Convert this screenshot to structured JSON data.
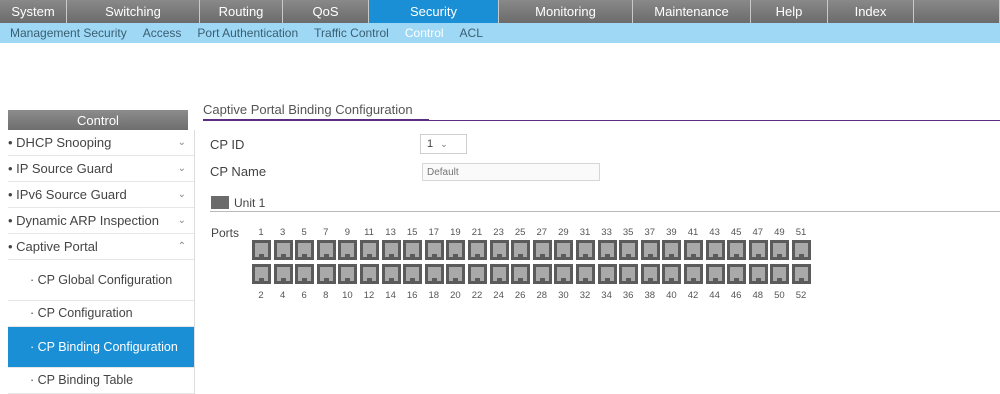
{
  "nav": {
    "tabs": [
      {
        "label": "System",
        "width": 67,
        "active": false
      },
      {
        "label": "Switching",
        "width": 133,
        "active": false
      },
      {
        "label": "Routing",
        "width": 83,
        "active": false
      },
      {
        "label": "QoS",
        "width": 86,
        "active": false
      },
      {
        "label": "Security",
        "width": 130,
        "active": true
      },
      {
        "label": "Monitoring",
        "width": 134,
        "active": false
      },
      {
        "label": "Maintenance",
        "width": 118,
        "active": false
      },
      {
        "label": "Help",
        "width": 77,
        "active": false
      },
      {
        "label": "Index",
        "width": 86,
        "active": false
      },
      {
        "label": "",
        "width": 86,
        "active": false
      }
    ],
    "subitems": [
      {
        "label": "Management Security",
        "active": false
      },
      {
        "label": "Access",
        "active": false
      },
      {
        "label": "Port Authentication",
        "active": false
      },
      {
        "label": "Traffic Control",
        "active": false
      },
      {
        "label": "Control",
        "active": true
      },
      {
        "label": "ACL",
        "active": false
      }
    ]
  },
  "sidebar": {
    "title": "Control",
    "items": [
      {
        "label": "• DHCP Snooping",
        "chevron": "⌄",
        "sub": false
      },
      {
        "label": "• IP Source Guard",
        "chevron": "⌄",
        "sub": false
      },
      {
        "label": "• IPv6 Source Guard",
        "chevron": "⌄",
        "sub": false
      },
      {
        "label": "• Dynamic ARP Inspection",
        "chevron": "⌄",
        "sub": false
      },
      {
        "label": "• Captive Portal",
        "chevron": "⌃",
        "sub": false
      },
      {
        "label": "· CP Global Configuration",
        "chevron": "",
        "sub": true,
        "tall": true
      },
      {
        "label": "· CP Configuration",
        "chevron": "",
        "sub": true
      },
      {
        "label": "· CP Binding Configuration",
        "chevron": "",
        "sub": true,
        "tall": true,
        "selected": true
      },
      {
        "label": "· CP Binding Table",
        "chevron": "",
        "sub": true
      }
    ]
  },
  "main": {
    "title": "Captive Portal Binding Configuration",
    "cp_id_label": "CP ID",
    "cp_id_value": "1",
    "cp_name_label": "CP Name",
    "cp_name_value": "Default",
    "unit_label": "Unit 1",
    "ports_label": "Ports",
    "top_ports": [
      "1",
      "3",
      "5",
      "7",
      "9",
      "11",
      "13",
      "15",
      "17",
      "19",
      "21",
      "23",
      "25",
      "27",
      "29",
      "31",
      "33",
      "35",
      "37",
      "39",
      "41",
      "43",
      "45",
      "47",
      "49",
      "51"
    ],
    "bottom_ports": [
      "2",
      "4",
      "6",
      "8",
      "10",
      "12",
      "14",
      "16",
      "18",
      "20",
      "22",
      "24",
      "26",
      "28",
      "30",
      "32",
      "34",
      "36",
      "38",
      "40",
      "42",
      "44",
      "46",
      "48",
      "50",
      "52"
    ]
  },
  "icons": {
    "dropdown": "chevron-down-icon",
    "unit": "switch-unit-icon",
    "port": "port-icon"
  },
  "colors": {
    "accent": "#1a8fd6",
    "subnav_bg": "#9fd8f5",
    "title_rule": "#5a2d82"
  }
}
